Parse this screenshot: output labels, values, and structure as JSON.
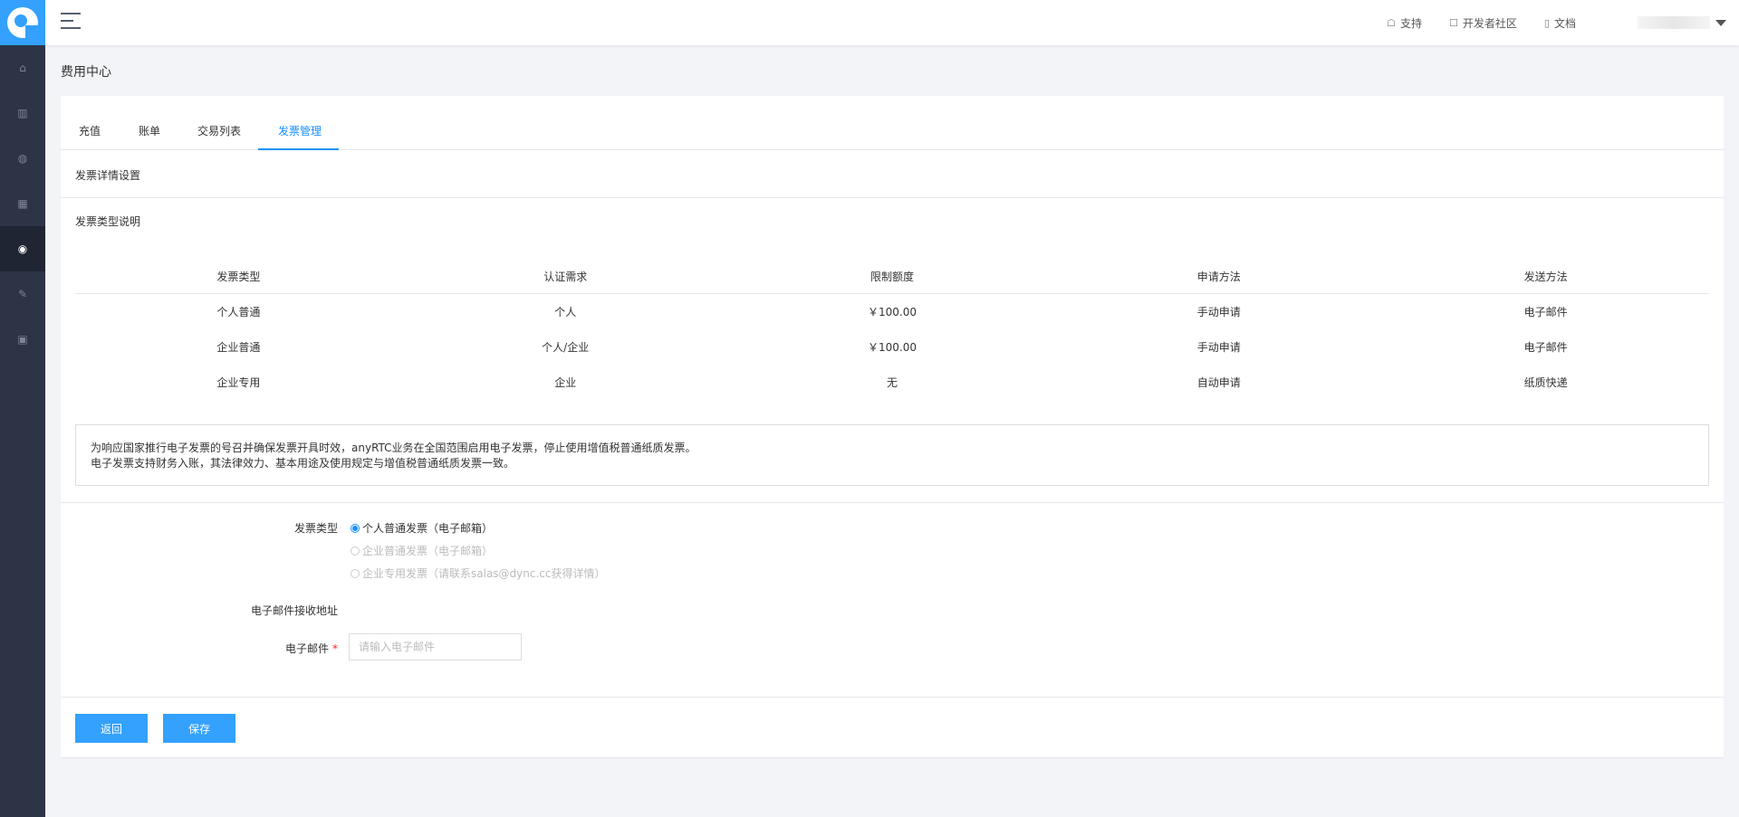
{
  "sidebar": {
    "items": [
      {
        "icon": "home-icon"
      },
      {
        "icon": "bar-chart-icon"
      },
      {
        "icon": "badge-icon"
      },
      {
        "icon": "dashboard-icon"
      },
      {
        "icon": "money-bag-icon",
        "active": true
      },
      {
        "icon": "wrench-icon"
      },
      {
        "icon": "gift-icon"
      }
    ]
  },
  "topbar": {
    "links": [
      {
        "icon": "headset-icon",
        "label": "支持"
      },
      {
        "icon": "chat-icon",
        "label": "开发者社区"
      },
      {
        "icon": "document-icon",
        "label": "文档"
      }
    ]
  },
  "page": {
    "title": "费用中心"
  },
  "tabs": [
    "充值",
    "账单",
    "交易列表",
    "发票管理"
  ],
  "active_tab": "发票管理",
  "sections": {
    "details": "发票详情设置",
    "types_desc": "发票类型说明"
  },
  "table": {
    "headers": [
      "发票类型",
      "认证需求",
      "限制额度",
      "申请方法",
      "发送方法"
    ],
    "rows": [
      [
        "个人普通",
        "个人",
        "￥100.00",
        "手动申请",
        "电子邮件"
      ],
      [
        "企业普通",
        "个人/企业",
        "￥100.00",
        "手动申请",
        "电子邮件"
      ],
      [
        "企业专用",
        "企业",
        "无",
        "自动申请",
        "纸质快递"
      ]
    ]
  },
  "notice": {
    "line1": "为响应国家推行电子发票的号召并确保发票开具时效，anyRTC业务在全国范围启用电子发票，停止使用增值税普通纸质发票。",
    "line2": "电子发票支持财务入账，其法律效力、基本用途及使用规定与增值税普通纸质发票一致。"
  },
  "form": {
    "type_label": "发票类型",
    "options": [
      {
        "label": "个人普通发票（电子邮箱）",
        "selected": true,
        "disabled": false
      },
      {
        "label": "企业普通发票（电子邮箱）",
        "selected": false,
        "disabled": true
      },
      {
        "label": "企业专用发票（请联系salas@dync.cc获得详情）",
        "selected": false,
        "disabled": true
      }
    ],
    "email_section": "电子邮件接收地址",
    "email_label": "电子邮件",
    "email_required": "*",
    "email_placeholder": "请输入电子邮件",
    "email_value": ""
  },
  "buttons": {
    "back": "返回",
    "save": "保存"
  },
  "colors": {
    "accent": "#33a1fd",
    "sidebar": "#2d3446",
    "tab_active": "#1890ff"
  }
}
